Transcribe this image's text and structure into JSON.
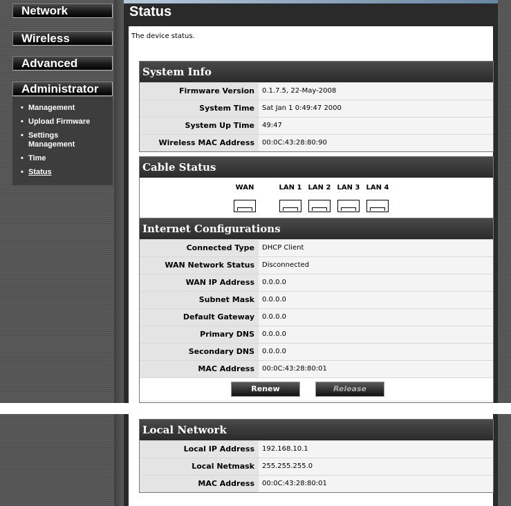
{
  "sidebar": {
    "menu": [
      "Network",
      "Wireless",
      "Advanced",
      "Administrator"
    ],
    "submenu": [
      "Management",
      "Upload Firmware",
      "Settings Management",
      "Time",
      "Status"
    ]
  },
  "page": {
    "title": "Status",
    "description": "The device status."
  },
  "system_info": {
    "heading": "System Info",
    "rows": [
      {
        "label": "Firmware Version",
        "value": "0.1.7.5, 22-May-2008"
      },
      {
        "label": "System Time",
        "value": "Sat Jan 1 0:49:47 2000"
      },
      {
        "label": "System Up Time",
        "value": "49:47"
      },
      {
        "label": "Wireless MAC Address",
        "value": "00:0C:43:28:80:90"
      }
    ]
  },
  "cable_status": {
    "heading": "Cable Status",
    "ports": [
      "WAN",
      "LAN 1",
      "LAN 2",
      "LAN 3",
      "LAN 4"
    ]
  },
  "internet": {
    "heading": "Internet Configurations",
    "rows": [
      {
        "label": "Connected Type",
        "value": "DHCP Client"
      },
      {
        "label": "WAN Network Status",
        "value": "Disconnected"
      },
      {
        "label": "WAN IP Address",
        "value": "0.0.0.0"
      },
      {
        "label": "Subnet Mask",
        "value": "0.0.0.0"
      },
      {
        "label": "Default Gateway",
        "value": "0.0.0.0"
      },
      {
        "label": "Primary DNS",
        "value": "0.0.0.0"
      },
      {
        "label": "Secondary DNS",
        "value": "0.0.0.0"
      },
      {
        "label": "MAC Address",
        "value": "00:0C:43:28:80:01"
      }
    ],
    "renew_label": "Renew",
    "release_label": "Release"
  },
  "local_network": {
    "heading": "Local Network",
    "rows": [
      {
        "label": "Local IP Address",
        "value": "192.168.10.1"
      },
      {
        "label": "Local Netmask",
        "value": "255.255.255.0"
      },
      {
        "label": "MAC Address",
        "value": "00:0C:43:28:80:01"
      }
    ]
  }
}
